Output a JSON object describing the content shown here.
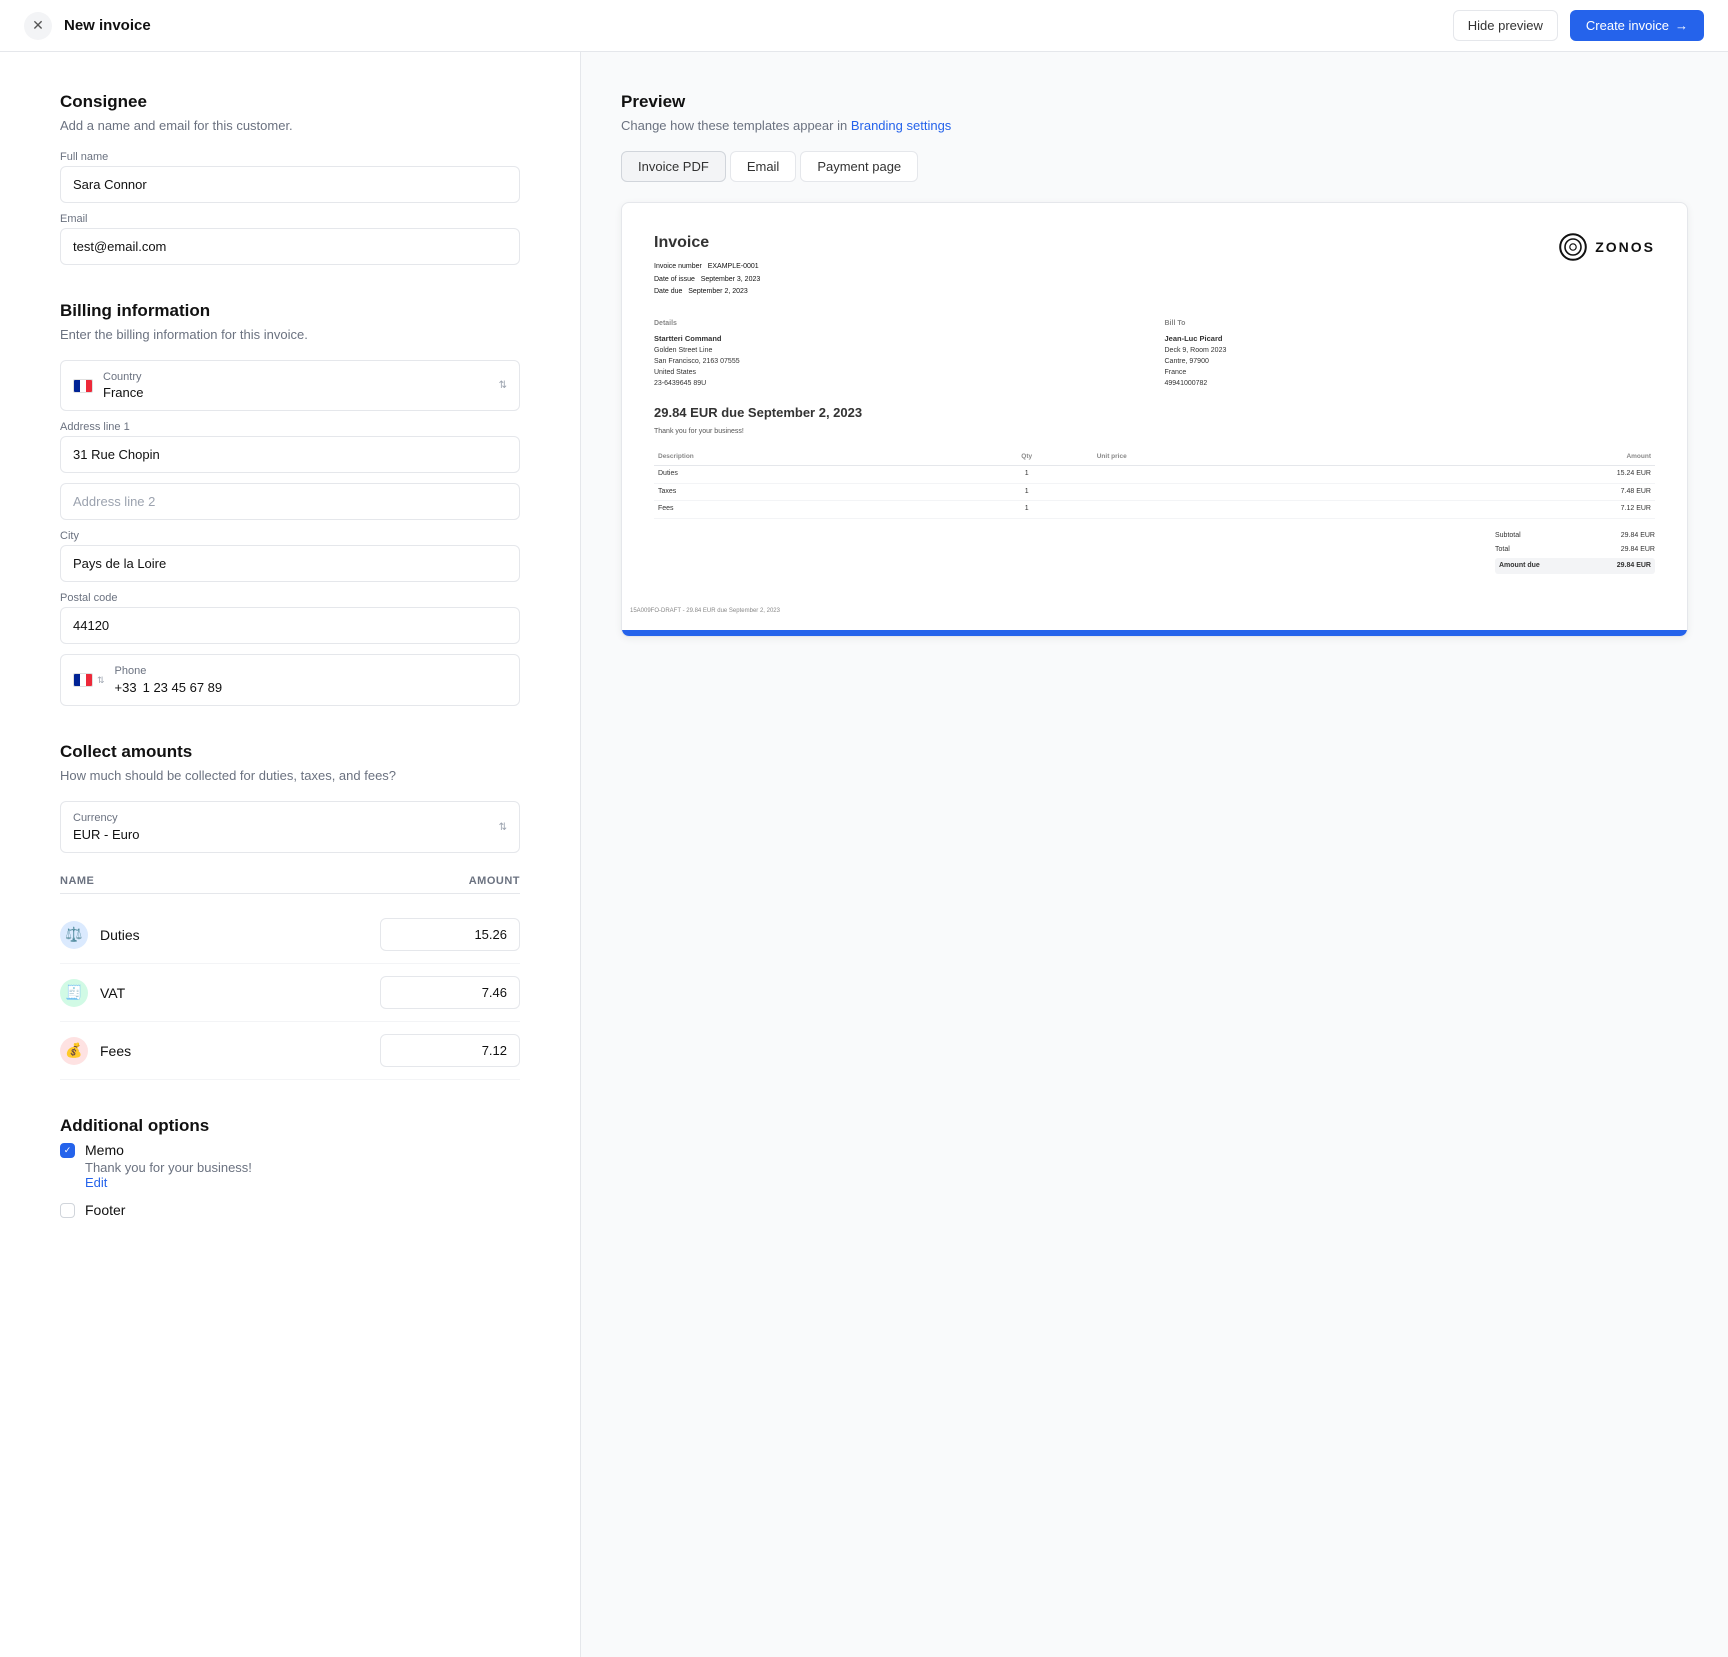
{
  "header": {
    "title": "New invoice",
    "hide_preview_label": "Hide preview",
    "create_invoice_label": "Create invoice"
  },
  "consignee": {
    "title": "Consignee",
    "description": "Add a name and email for this customer.",
    "full_name_label": "Full name",
    "full_name_value": "Sara Connor",
    "email_label": "Email",
    "email_value": "test@email.com"
  },
  "billing": {
    "title": "Billing information",
    "description": "Enter the billing information for this invoice.",
    "country_label": "Country",
    "country_value": "France",
    "address1_label": "Address line 1",
    "address1_value": "31 Rue Chopin",
    "address2_label": "Address line 2",
    "address2_value": "",
    "city_label": "City",
    "city_value": "Pays de la Loire",
    "postal_label": "Postal code",
    "postal_value": "44120",
    "phone_label": "Phone",
    "phone_code": "+33",
    "phone_value": "1 23 45 67 89"
  },
  "collect": {
    "title": "Collect amounts",
    "description": "How much should be collected for duties, taxes, and fees?",
    "currency_label": "Currency",
    "currency_value": "EUR - Euro",
    "amounts_name_header": "NAME",
    "amounts_amount_header": "AMOUNT",
    "amounts": [
      {
        "name": "Duties",
        "value": "15.26",
        "icon": "⚖️",
        "bg": "#dbeafe"
      },
      {
        "name": "VAT",
        "value": "7.46",
        "icon": "🧾",
        "bg": "#d1fae5"
      },
      {
        "name": "Fees",
        "value": "7.12",
        "icon": "💰",
        "bg": "#fee2e2"
      }
    ]
  },
  "additional": {
    "title": "Additional options",
    "memo_label": "Memo",
    "memo_checked": true,
    "memo_value": "Thank you for your business!",
    "edit_label": "Edit",
    "footer_label": "Footer",
    "footer_checked": false
  },
  "preview": {
    "title": "Preview",
    "description_text": "Change how these templates appear in",
    "branding_link": "Branding settings",
    "tabs": [
      "Invoice PDF",
      "Email",
      "Payment page"
    ],
    "active_tab": 0,
    "invoice": {
      "title": "Invoice",
      "invoice_number_label": "Invoice number",
      "invoice_number_value": "EXAMPLE-0001",
      "date_issue_label": "Date of issue",
      "date_issue_value": "September 3, 2023",
      "date_due_label": "Date due",
      "date_due_value": "September 2, 2023",
      "amount_banner": "29.84 EUR due September 2, 2023",
      "thank_you": "Thank you for your business!",
      "details_label": "Details",
      "bill_from_name": "Startteri Command",
      "bill_from_addr": "Golden Street Line",
      "bill_from_city": "San Francisco, 2163 07555",
      "bill_from_country": "United States",
      "bill_from_tax": "23-6439645 89U",
      "bill_to_label": "Bill To",
      "bill_to_name": "Jean-Luc Picard",
      "bill_to_addr": "Deck 9, Room 2023",
      "bill_to_city": "Cantre, 97900",
      "bill_to_country": "France",
      "bill_to_phone": "49941000782",
      "table_cols": [
        "Description",
        "Qty",
        "Unit price",
        "Amount"
      ],
      "table_rows": [
        [
          "Duties",
          "1",
          "",
          "15.24 EUR"
        ],
        [
          "Taxes",
          "1",
          "",
          "7.48 EUR"
        ],
        [
          "Fees",
          "1",
          "",
          "7.12 EUR"
        ]
      ],
      "subtotal_label": "Subtotal",
      "subtotal_value": "29.84 EUR",
      "total_label": "Total",
      "total_value": "29.84 EUR",
      "amount_due_label": "Amount due",
      "amount_due_value": "29.84 EUR",
      "footer_text": "15A009FO-DRAFT - 29.84 EUR due September 2, 2023"
    }
  }
}
